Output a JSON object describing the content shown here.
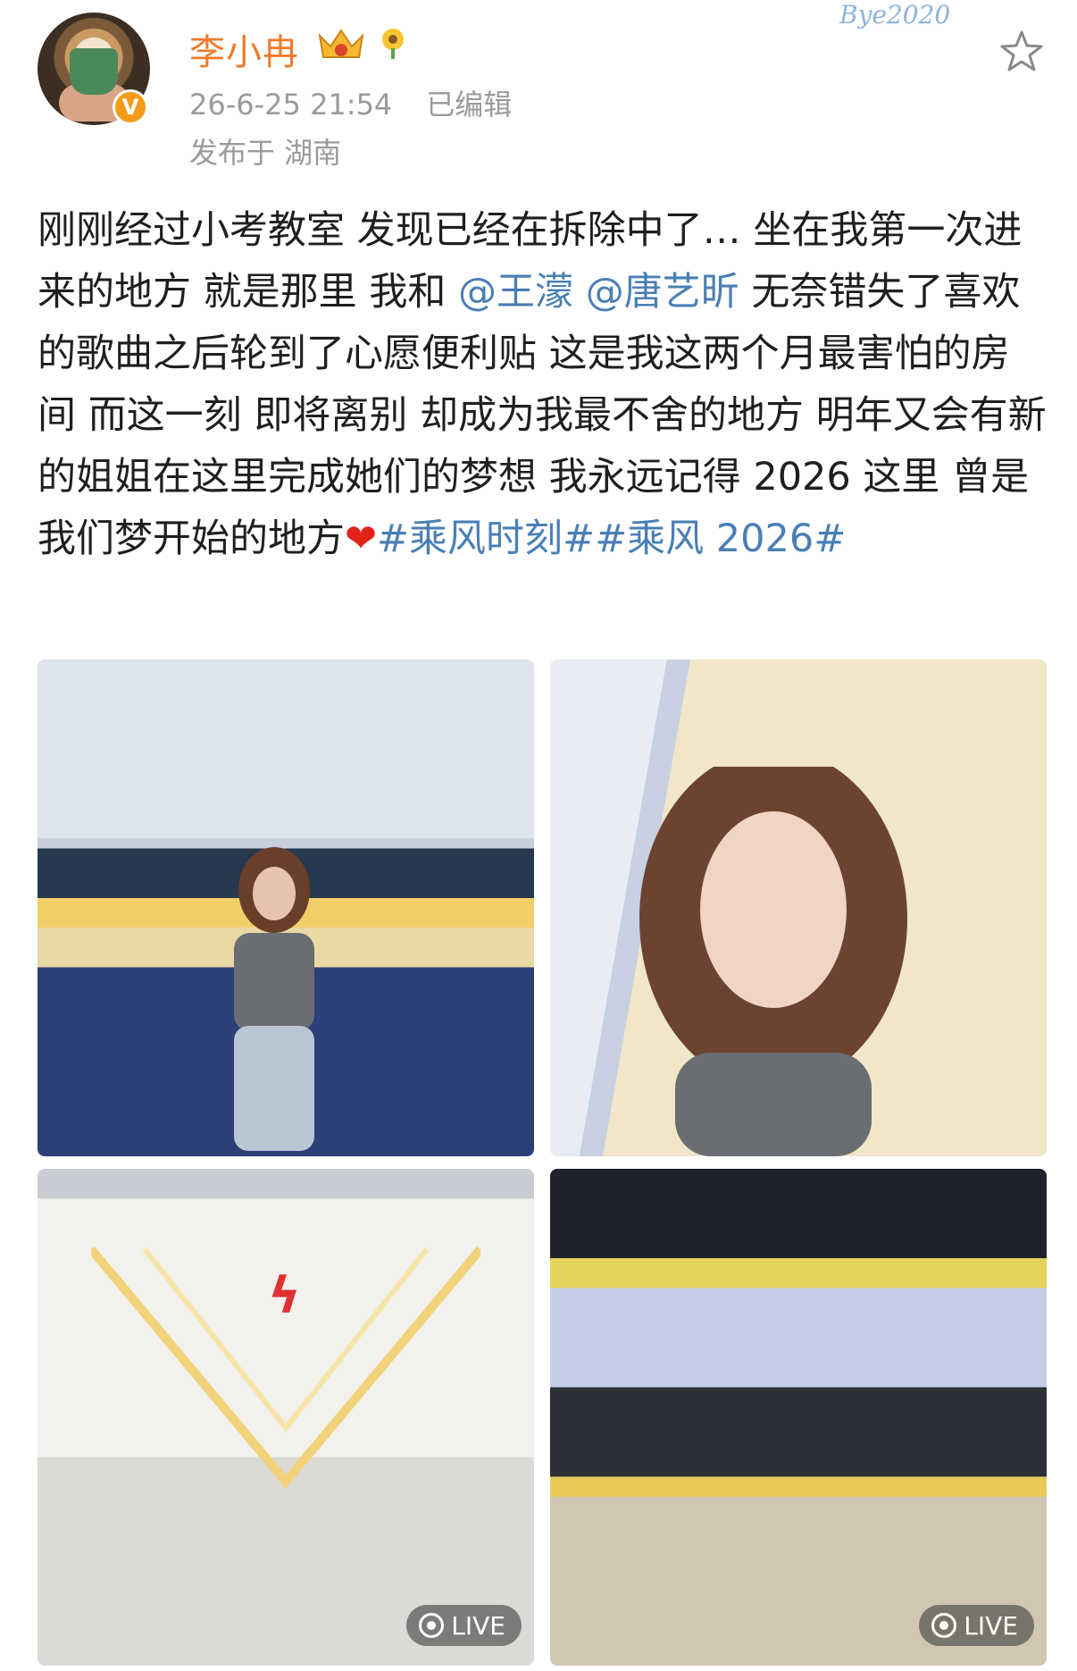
{
  "header": {
    "username": "李小冉",
    "timestamp": "26-6-25 21:54",
    "edited": "已编辑",
    "location": "发布于 湖南",
    "decoration": "Bye2020",
    "verified_mark": "V"
  },
  "post": {
    "segments": [
      {
        "text": "刚刚经过小考教室 发现已经在拆除中了… 坐在我第一次进来的地方 就是那里 我和 ",
        "type": "text"
      },
      {
        "text": "@王濛",
        "type": "mention"
      },
      {
        "text": " ",
        "type": "text"
      },
      {
        "text": "@唐艺昕",
        "type": "mention"
      },
      {
        "text": " 无奈错失了喜欢的歌曲之后轮到了心愿便利贴 这是我这两个月最害怕的房间 而这一刻 即将离别 却成为我最不舍的地方 明年又会有新的姐姐在这里完成她们的梦想 我永远记得 2026 这里 曾是我们梦开始的地方",
        "type": "text"
      },
      {
        "text": "❤",
        "type": "heart"
      },
      {
        "text": "#乘风时刻#",
        "type": "tag"
      },
      {
        "text": "#乘风 2026#",
        "type": "tag"
      }
    ]
  },
  "photos": [
    {
      "label": "",
      "live": false
    },
    {
      "label": "",
      "live": false
    },
    {
      "label": "LIVE",
      "live": true
    },
    {
      "label": "LIVE",
      "live": true
    }
  ],
  "colors": {
    "username": "#f07a2a",
    "link": "#4a7fb5",
    "meta": "#9a9a9a"
  }
}
